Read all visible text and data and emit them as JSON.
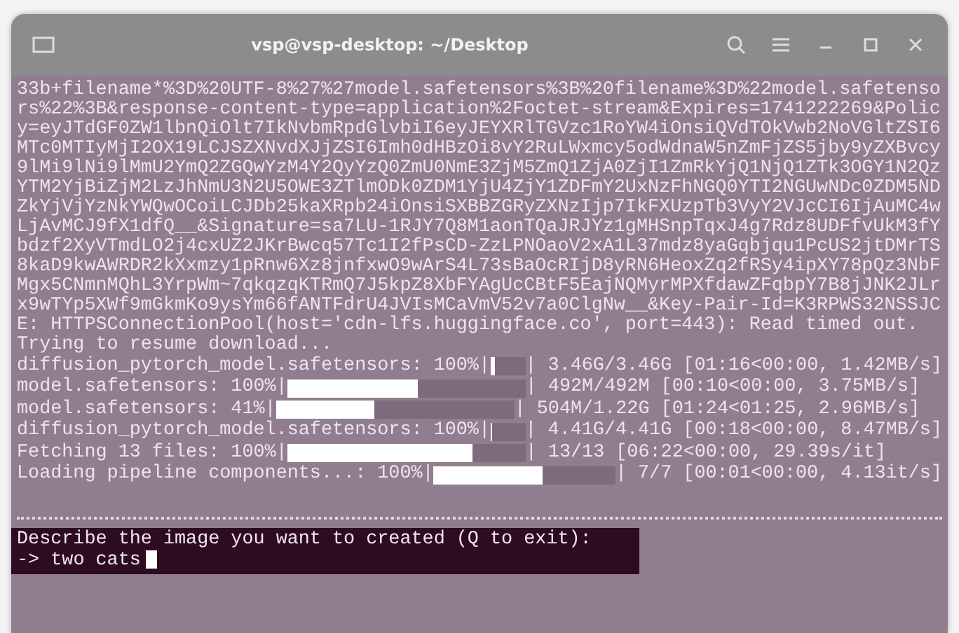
{
  "window": {
    "title": "vsp@vsp-desktop: ~/Desktop"
  },
  "log_text": "33b+filename*%3D%20UTF-8%27%27model.safetensors%3B%20filename%3D%22model.safetensors%22%3B&response-content-type=application%2Foctet-stream&Expires=1741222269&Policy=eyJTdGF0ZW1lbnQiOlt7IkNvbmRpdGlvbiI6eyJEYXRlTGVzc1RoYW4iOnsiQVdTOkVwb2NoVGltZSI6MTc0MTIyMjI2OX19LCJSZXNvdXJjZSI6Imh0dHBzOi8vY2RuLWxmcy5odWdnaW5nZmFjZS5jby9yZXBvcy9lMi9lNi9lMmU2YmQ2ZGQwYzM4Y2QyYzQ0ZmU0NmE3ZjM5ZmQ1ZjA0ZjI1ZmRkYjQ1NjQ1ZTk3OGY1N2QzYTM2YjBiZjM2LzJhNmU3N2U5OWE3ZTlmODk0ZDM1YjU4ZjY1ZDFmY2UxNzFhNGQ0YTI2NGUwNDc0ZDM5NDZkYjVjYzNkYWQwOCoiLCJDb25kaXRpb24iOnsiSXBBZGRyZXNzIjp7IkFXUzpTb3VyY2VJcCI6IjAuMC4wLjAvMCJ9fX1dfQ__&Signature=sa7LU-1RJY7Q8M1aonTQaJRJYz1gMHSnpTqxJ4g7Rdz8UDFfvUkM3fYbdzf2XyVTmdLO2j4cxUZ2JKrBwcq57Tc1I2fPsCD-ZzLPNOaoV2xA1L37mdz8yaGqbjqu1PcUS2jtDMrTS8kaD9kwAWRDR2kXxmzy1pRnw6Xz8jnfxwO9wArS4L73sBaOcRIjD8yRN6HeoxZq2fRSy4ipXY78pQz3NbFMgx5CNmnMQhL3YrpWm~7qkqzqKTRmQ7J5kpZ8XbFYAgUcCBtF5EajNQMyrMPXfdawZFqbpY7B8jJNK2JLrx9wTYp5XWf9mGkmKo9ysYm66fANTFdrU4JVIsMCaVmV52v7a0ClgNw__&Key-Pair-Id=K3RPWS32NSSJCE: HTTPSConnectionPool(host='cdn-lfs.huggingface.co', port=443): Read timed out.",
  "status_line": "Trying to resume download...",
  "progress_rows": [
    {
      "label": "diffusion_pytorch_model.safetensors: 100%|",
      "level": 0.12,
      "detail": "| 3.46G/3.46G [01:16<00:00, 1.42MB/s]"
    },
    {
      "label": "model.safetensors: 100%|",
      "level": 0.55,
      "detail": "| 492M/492M [00:10<00:00, 3.75MB/s]"
    },
    {
      "label": "model.safetensors: 41%|",
      "level": 0.41,
      "detail": "| 504M/1.22G [01:24<01:25, 2.96MB/s]"
    },
    {
      "label": "diffusion_pytorch_model.safetensors: 100%|",
      "level": 0.06,
      "detail": "| 4.41G/4.41G [00:18<00:00, 8.47MB/s]"
    },
    {
      "label": "Fetching 13 files: 100%|",
      "level": 0.78,
      "detail": "| 13/13 [06:22<00:00, 29.39s/it]"
    },
    {
      "label": "Loading pipeline components...: 100%|",
      "level": 0.6,
      "detail": "| 7/7 [00:01<00:00, 4.13it/s]"
    }
  ],
  "prompt": {
    "question": "Describe the image you want to created (Q to exit):",
    "arrow": "->",
    "input": "two cats"
  }
}
